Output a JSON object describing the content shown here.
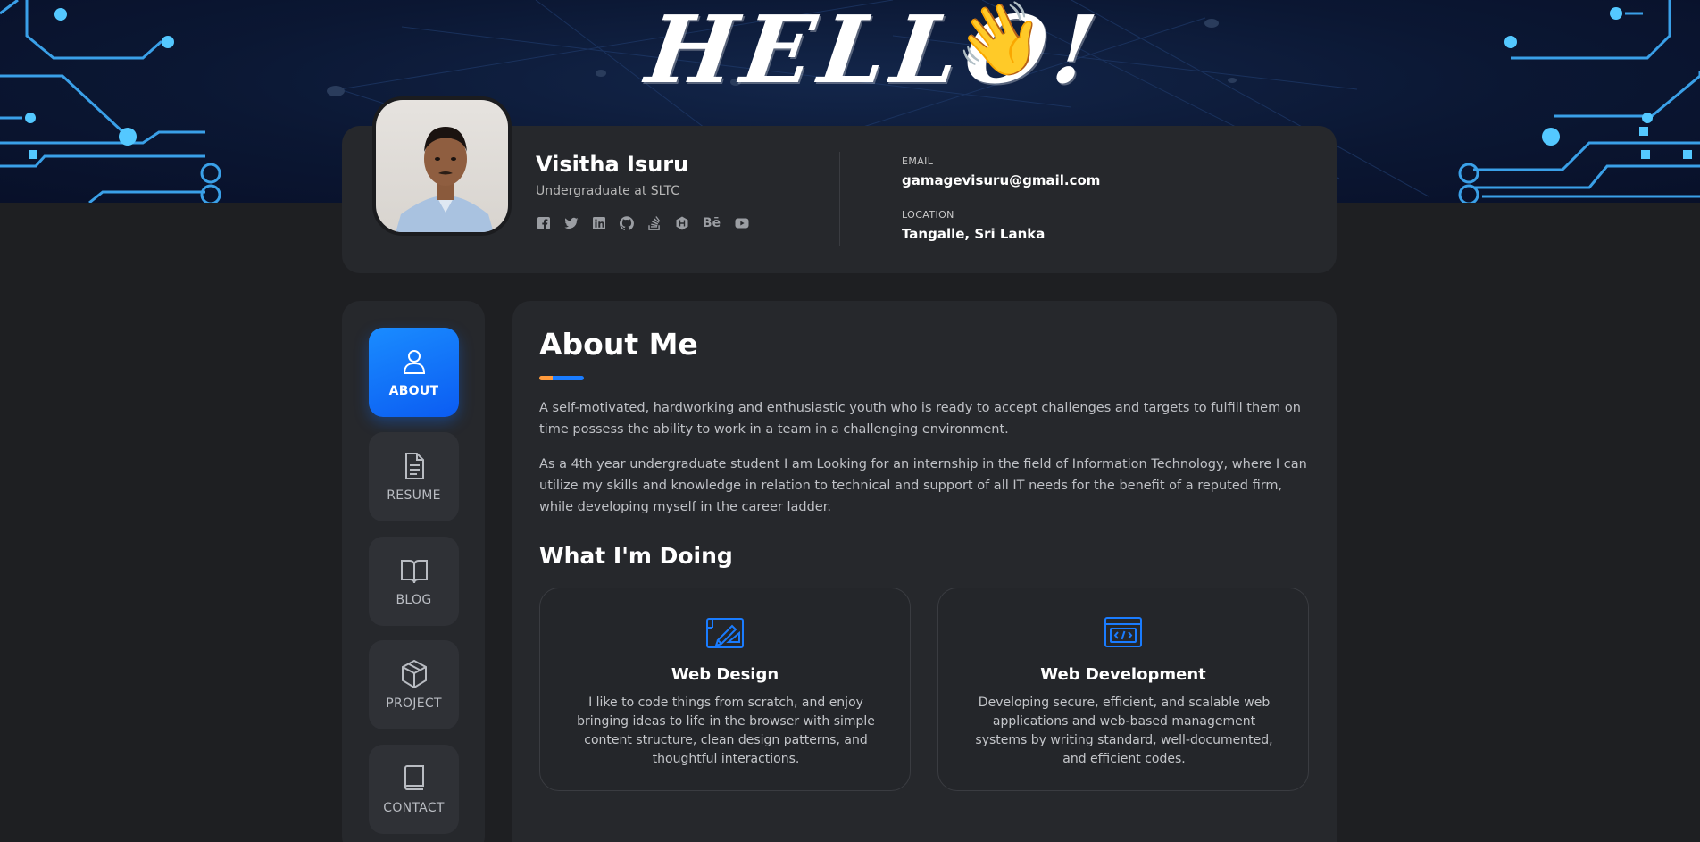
{
  "banner": {
    "greeting": "HELLO!",
    "wave_emoji": "👋"
  },
  "profile": {
    "name": "Visitha Isuru",
    "role": "Undergraduate at SLTC",
    "socials": [
      "facebook-icon",
      "twitter-icon",
      "linkedin-icon",
      "github-icon",
      "stackoverflow-icon",
      "hackerrank-icon",
      "behance-icon",
      "youtube-icon"
    ],
    "behance_text": "Bē",
    "email_label": "EMAIL",
    "email": "gamagevisuru@gmail.com",
    "location_label": "LOCATION",
    "location": "Tangalle, Sri Lanka"
  },
  "nav": {
    "items": [
      {
        "label": "ABOUT",
        "icon": "user-icon",
        "active": true
      },
      {
        "label": "RESUME",
        "icon": "document-icon",
        "active": false
      },
      {
        "label": "BLOG",
        "icon": "open-book-icon",
        "active": false
      },
      {
        "label": "PROJECT",
        "icon": "cube-icon",
        "active": false
      },
      {
        "label": "CONTACT",
        "icon": "book-icon",
        "active": false
      }
    ]
  },
  "about": {
    "title": "About Me",
    "paragraphs": [
      "A self-motivated, hardworking and enthusiastic youth who is ready to accept challenges and targets to fulfill them on time possess the ability to work in a team in a challenging environment.",
      "As a 4th year undergraduate student I am Looking for an internship in the field of Information Technology, where I can utilize my skills and knowledge in relation to technical and support of all IT needs for the benefit of a reputed firm, while developing myself in the career ladder."
    ]
  },
  "doing": {
    "title": "What I'm Doing",
    "services": [
      {
        "title": "Web Design",
        "icon": "design-blueprint-icon",
        "text": "I like to code things from scratch, and enjoy bringing ideas to life in the browser with simple content structure, clean design patterns, and thoughtful interactions."
      },
      {
        "title": "Web Development",
        "icon": "code-window-icon",
        "text": "Developing secure, efficient, and scalable web applications and web-based management systems by writing standard, well-documented, and efficient codes."
      }
    ]
  },
  "colors": {
    "accent_blue": "#1a7cff",
    "accent_orange": "#ff9a3c",
    "card_bg": "#26282c",
    "page_bg": "#1e1f22"
  }
}
